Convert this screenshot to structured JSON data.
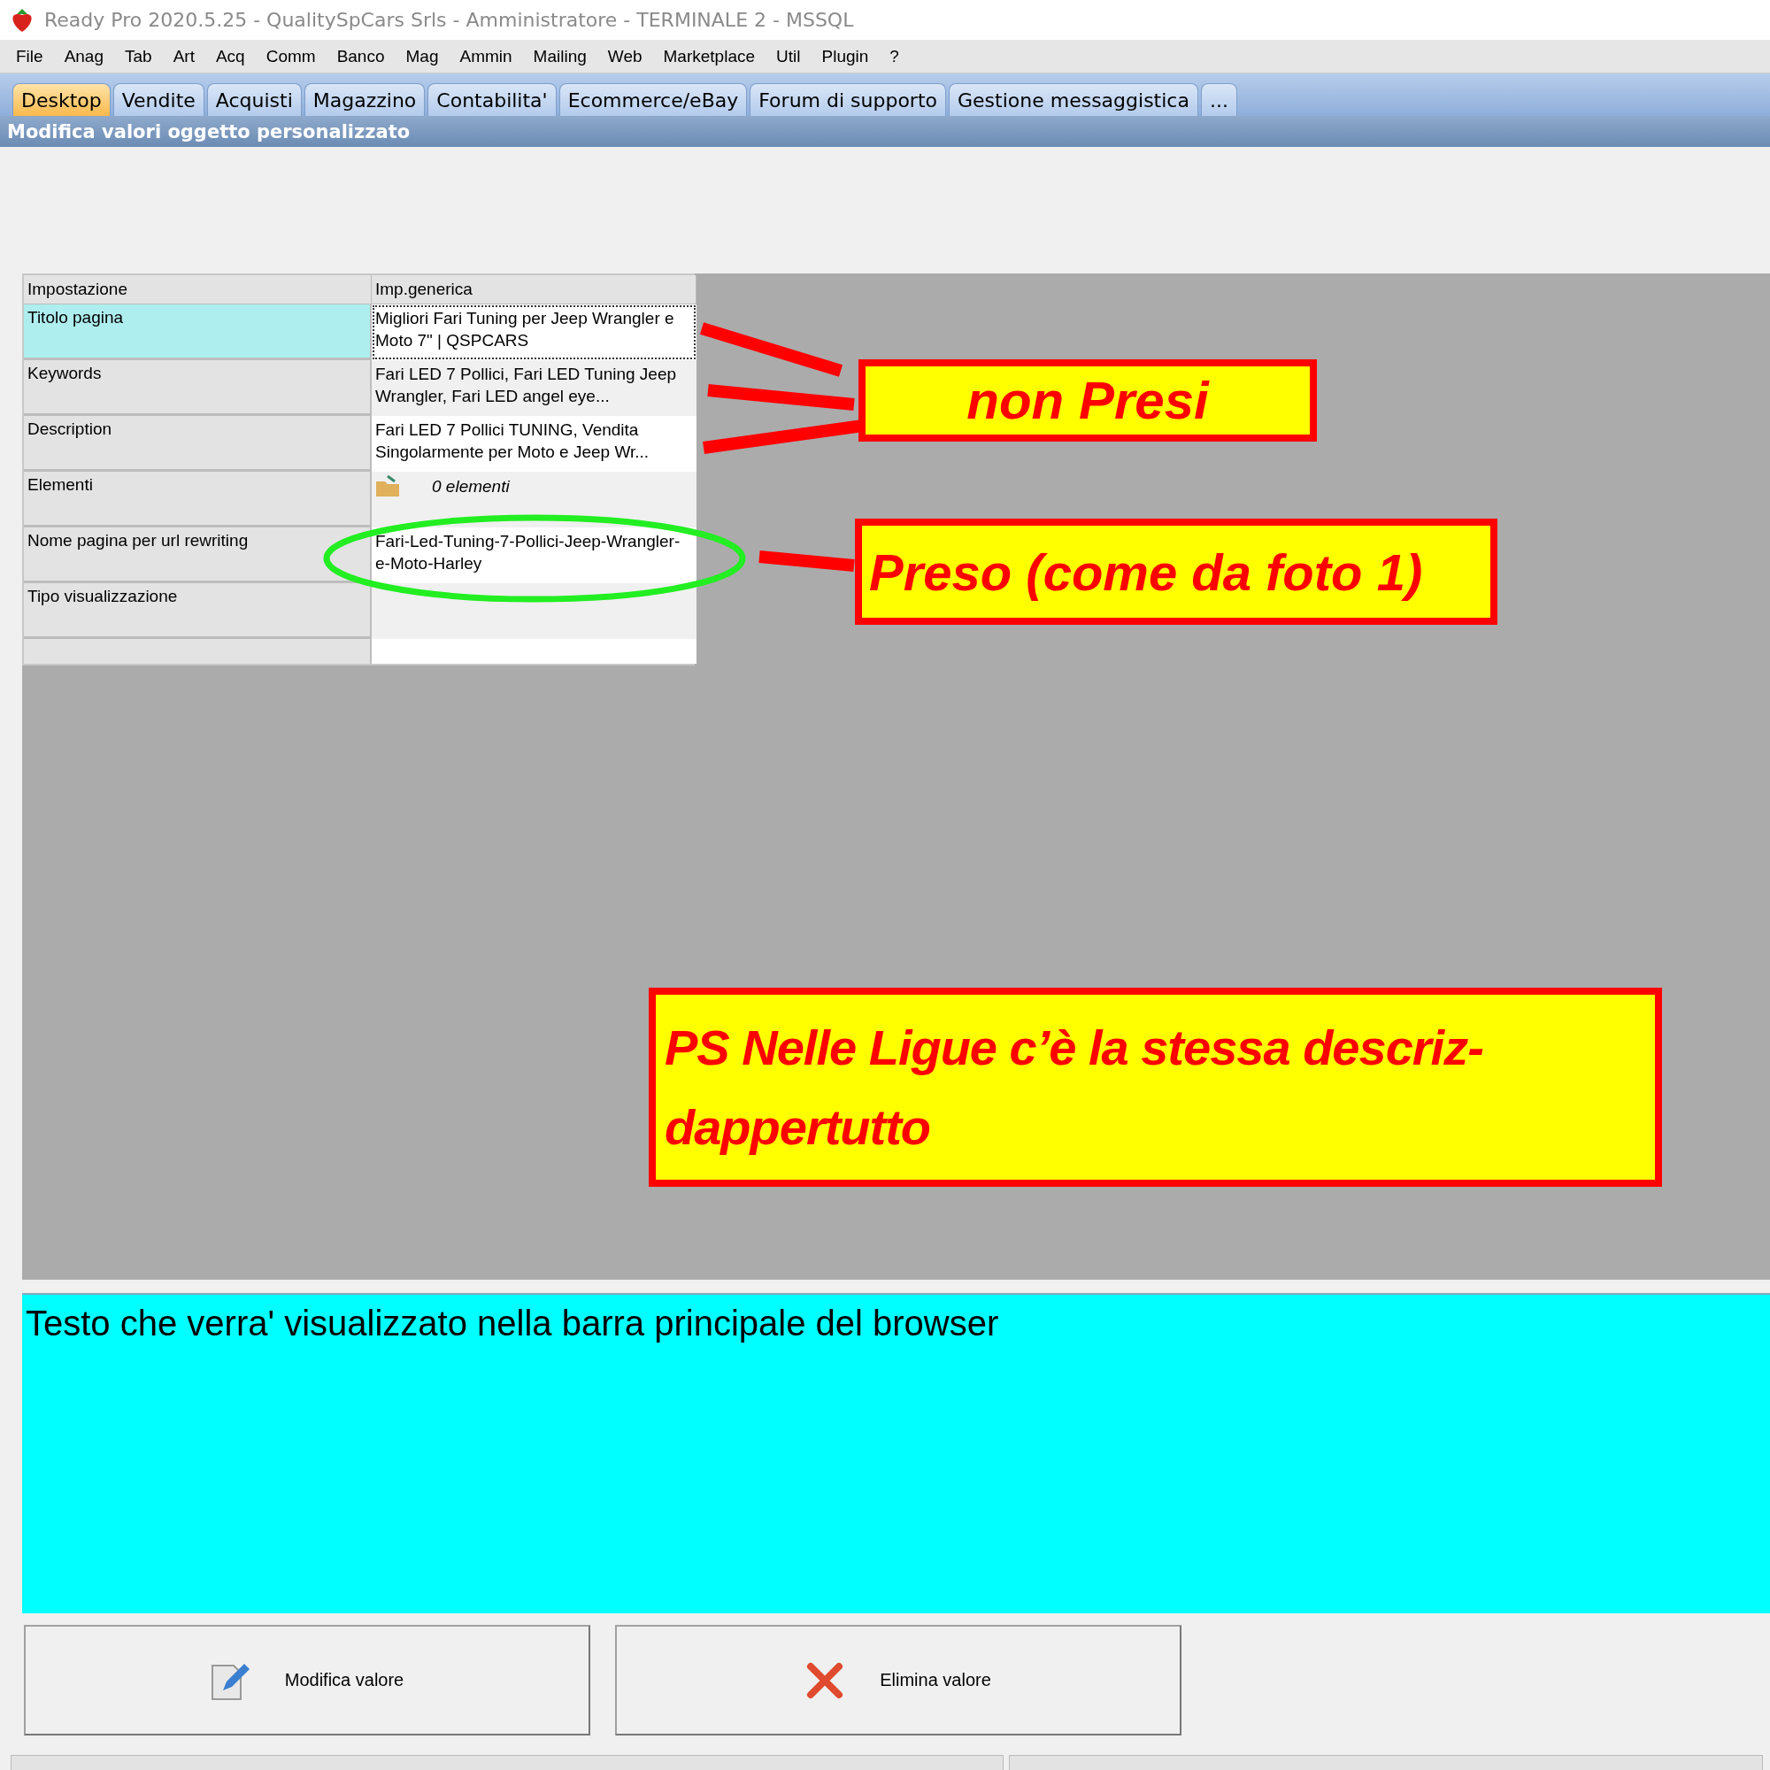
{
  "window": {
    "title": "Ready Pro 2020.5.25 - QualitySpCars Srls - Amministratore - TERMINALE 2 - MSSQL"
  },
  "menu": [
    "File",
    "Anag",
    "Tab",
    "Art",
    "Acq",
    "Comm",
    "Banco",
    "Mag",
    "Ammin",
    "Mailing",
    "Web",
    "Marketplace",
    "Util",
    "Plugin",
    "?"
  ],
  "tabs": [
    {
      "label": "Desktop",
      "selected": true
    },
    {
      "label": "Vendite",
      "selected": false
    },
    {
      "label": "Acquisti",
      "selected": false
    },
    {
      "label": "Magazzino",
      "selected": false
    },
    {
      "label": "Contabilita'",
      "selected": false
    },
    {
      "label": "Ecommerce/eBay",
      "selected": false
    },
    {
      "label": "Forum di supporto",
      "selected": false
    },
    {
      "label": "Gestione messaggistica",
      "selected": false
    },
    {
      "label": "...",
      "selected": false
    }
  ],
  "panel_title": "Modifica valori oggetto personalizzato",
  "table": {
    "columns": [
      "Impostazione",
      "Imp.generica"
    ],
    "rows": [
      {
        "kind": "text",
        "setting": "Titolo pagina",
        "value": "Migliori Fari Tuning per Jeep Wrangler e Moto 7\" | QSPCARS",
        "selected": true
      },
      {
        "kind": "text",
        "setting": "Keywords",
        "value": "Fari LED 7 Pollici, Fari LED Tuning Jeep Wrangler, Fari LED angel eye...",
        "selected": false
      },
      {
        "kind": "text",
        "setting": "Description",
        "value": "Fari LED 7 Pollici TUNING, Vendita Singolarmente per Moto e Jeep Wr...",
        "selected": false
      },
      {
        "kind": "elements",
        "setting": "Elementi",
        "value": "0 elementi",
        "selected": false
      },
      {
        "kind": "text",
        "setting": "Nome pagina per url rewriting",
        "value": "Fari-Led-Tuning-7-Pollici-Jeep-Wrangler-e-Moto-Harley",
        "selected": false
      },
      {
        "kind": "text",
        "setting": "Tipo visualizzazione",
        "selected": false
      }
    ]
  },
  "annotations": [
    {
      "text": "non Presi"
    },
    {
      "text": "Preso (come da foto 1)"
    },
    {
      "text": "PS Nelle Ligue c’è la stessa descriz- dappertutto"
    }
  ],
  "help_text": "Testo che verra' visualizzato nella barra principale del browser",
  "buttons": [
    {
      "kind": "edit",
      "label": "Modifica valore"
    },
    {
      "kind": "delete",
      "label": "Elimina valore"
    }
  ]
}
